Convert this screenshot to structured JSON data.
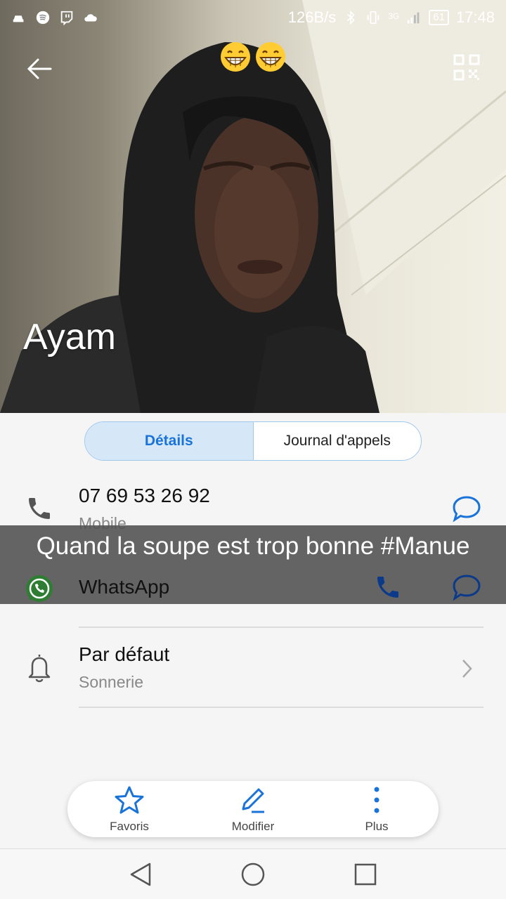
{
  "status_bar": {
    "net_speed": "126B/s",
    "network": "3G",
    "battery": "61",
    "time": "17:48"
  },
  "contact": {
    "name": "Ayam"
  },
  "tabs": [
    {
      "label": "Détails",
      "active": true
    },
    {
      "label": "Journal d'appels",
      "active": false
    }
  ],
  "phone": {
    "number": "07 69 53 26 92",
    "type": "Mobile"
  },
  "whatsapp": {
    "label": "WhatsApp"
  },
  "caption": {
    "text": "Quand la soupe est trop bonne #Manue"
  },
  "ringtone": {
    "title": "Par défaut",
    "subtitle": "Sonnerie"
  },
  "actions": [
    {
      "label": "Favoris",
      "icon": "star-icon"
    },
    {
      "label": "Modifier",
      "icon": "pencil-icon"
    },
    {
      "label": "Plus",
      "icon": "more-vertical-icon"
    }
  ],
  "colors": {
    "accent": "#1a73d9",
    "whatsapp": "#2e7d32",
    "caption_bg": "#505050"
  }
}
